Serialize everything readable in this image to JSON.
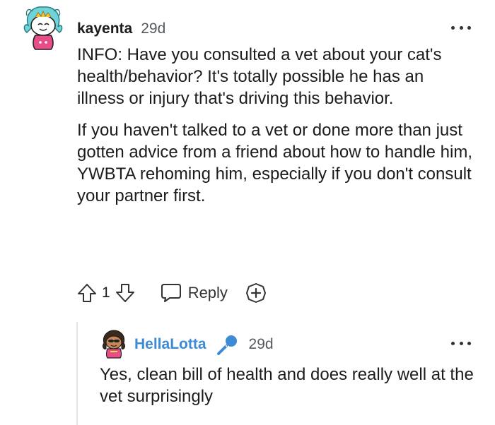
{
  "comment": {
    "author": "kayenta",
    "time": "29d",
    "paragraphs": [
      "INFO: Have you consulted a vet about your cat's health/behavior? It's totally possible he has an illness or injury that's driving this behavior.",
      "If you haven't talked to a vet or done more than just gotten advice from a friend about how to handle him, YWBTA rehoming him, especially if you don't consult your partner first."
    ],
    "vote_count": "1",
    "reply_label": "Reply",
    "icons": {
      "avatar": "snoo-avatar-icon",
      "upvote": "upvote-arrow-icon",
      "downvote": "downvote-arrow-icon",
      "reply": "speech-bubble-icon",
      "award": "award-plus-icon",
      "more": "more-options-icon"
    }
  },
  "reply": {
    "author": "HellaLotta",
    "time": "29d",
    "body": "Yes, clean bill of health and does really well at the vet surprisingly",
    "icons": {
      "avatar": "snoo-avatar-icon",
      "flair": "microphone-icon",
      "more": "more-options-icon"
    }
  },
  "colors": {
    "text": "#1c1c1c",
    "muted": "#555a5e",
    "reply_author": "#3d8ad6",
    "flair_blue": "#3d8ad6",
    "thread_line": "#e5e5e5"
  }
}
